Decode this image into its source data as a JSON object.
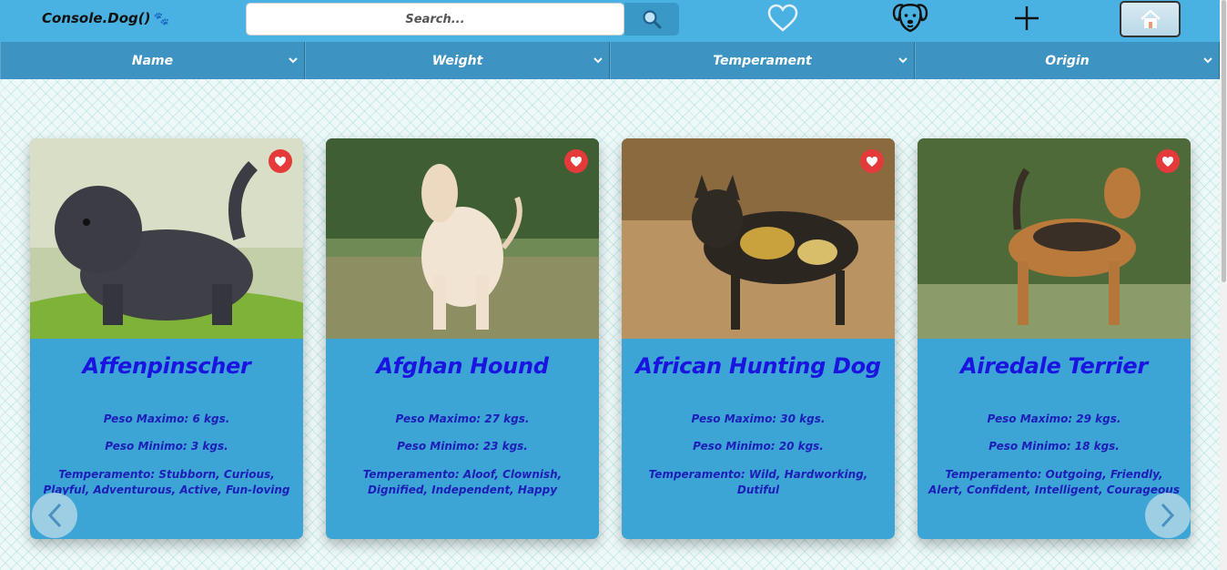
{
  "header": {
    "logo_text": "Console.Dog()",
    "logo_icon": "🐾",
    "search_placeholder": "Search...",
    "icons": [
      "search-icon",
      "heart-outline-icon",
      "dog-face-icon",
      "plus-icon",
      "home-icon"
    ]
  },
  "filters": [
    {
      "label": "Name"
    },
    {
      "label": "Weight"
    },
    {
      "label": "Temperament"
    },
    {
      "label": "Origin"
    }
  ],
  "cards": [
    {
      "name": "Affenpinscher",
      "max": "Peso Maximo: 6 kgs.",
      "min": "Peso Minimo: 3 kgs.",
      "temperament": "Temperamento: Stubborn, Curious, Playful, Adventurous, Active, Fun-loving"
    },
    {
      "name": "Afghan Hound",
      "max": "Peso Maximo: 27 kgs.",
      "min": "Peso Minimo: 23 kgs.",
      "temperament": "Temperamento: Aloof, Clownish, Dignified, Independent, Happy"
    },
    {
      "name": "African Hunting Dog",
      "max": "Peso Maximo: 30 kgs.",
      "min": "Peso Minimo: 20 kgs.",
      "temperament": "Temperamento: Wild, Hardworking, Dutiful"
    },
    {
      "name": "Airedale Terrier",
      "max": "Peso Maximo: 29 kgs.",
      "min": "Peso Minimo: 18 kgs.",
      "temperament": "Temperamento: Outgoing, Friendly, Alert, Confident, Intelligent, Courageous"
    }
  ],
  "colors": {
    "topbar": "#4ab2e2",
    "filterbar": "#3d94c3",
    "card": "#3da5d6",
    "card_title": "#1a14e0",
    "favorite": "#e53a3a"
  }
}
